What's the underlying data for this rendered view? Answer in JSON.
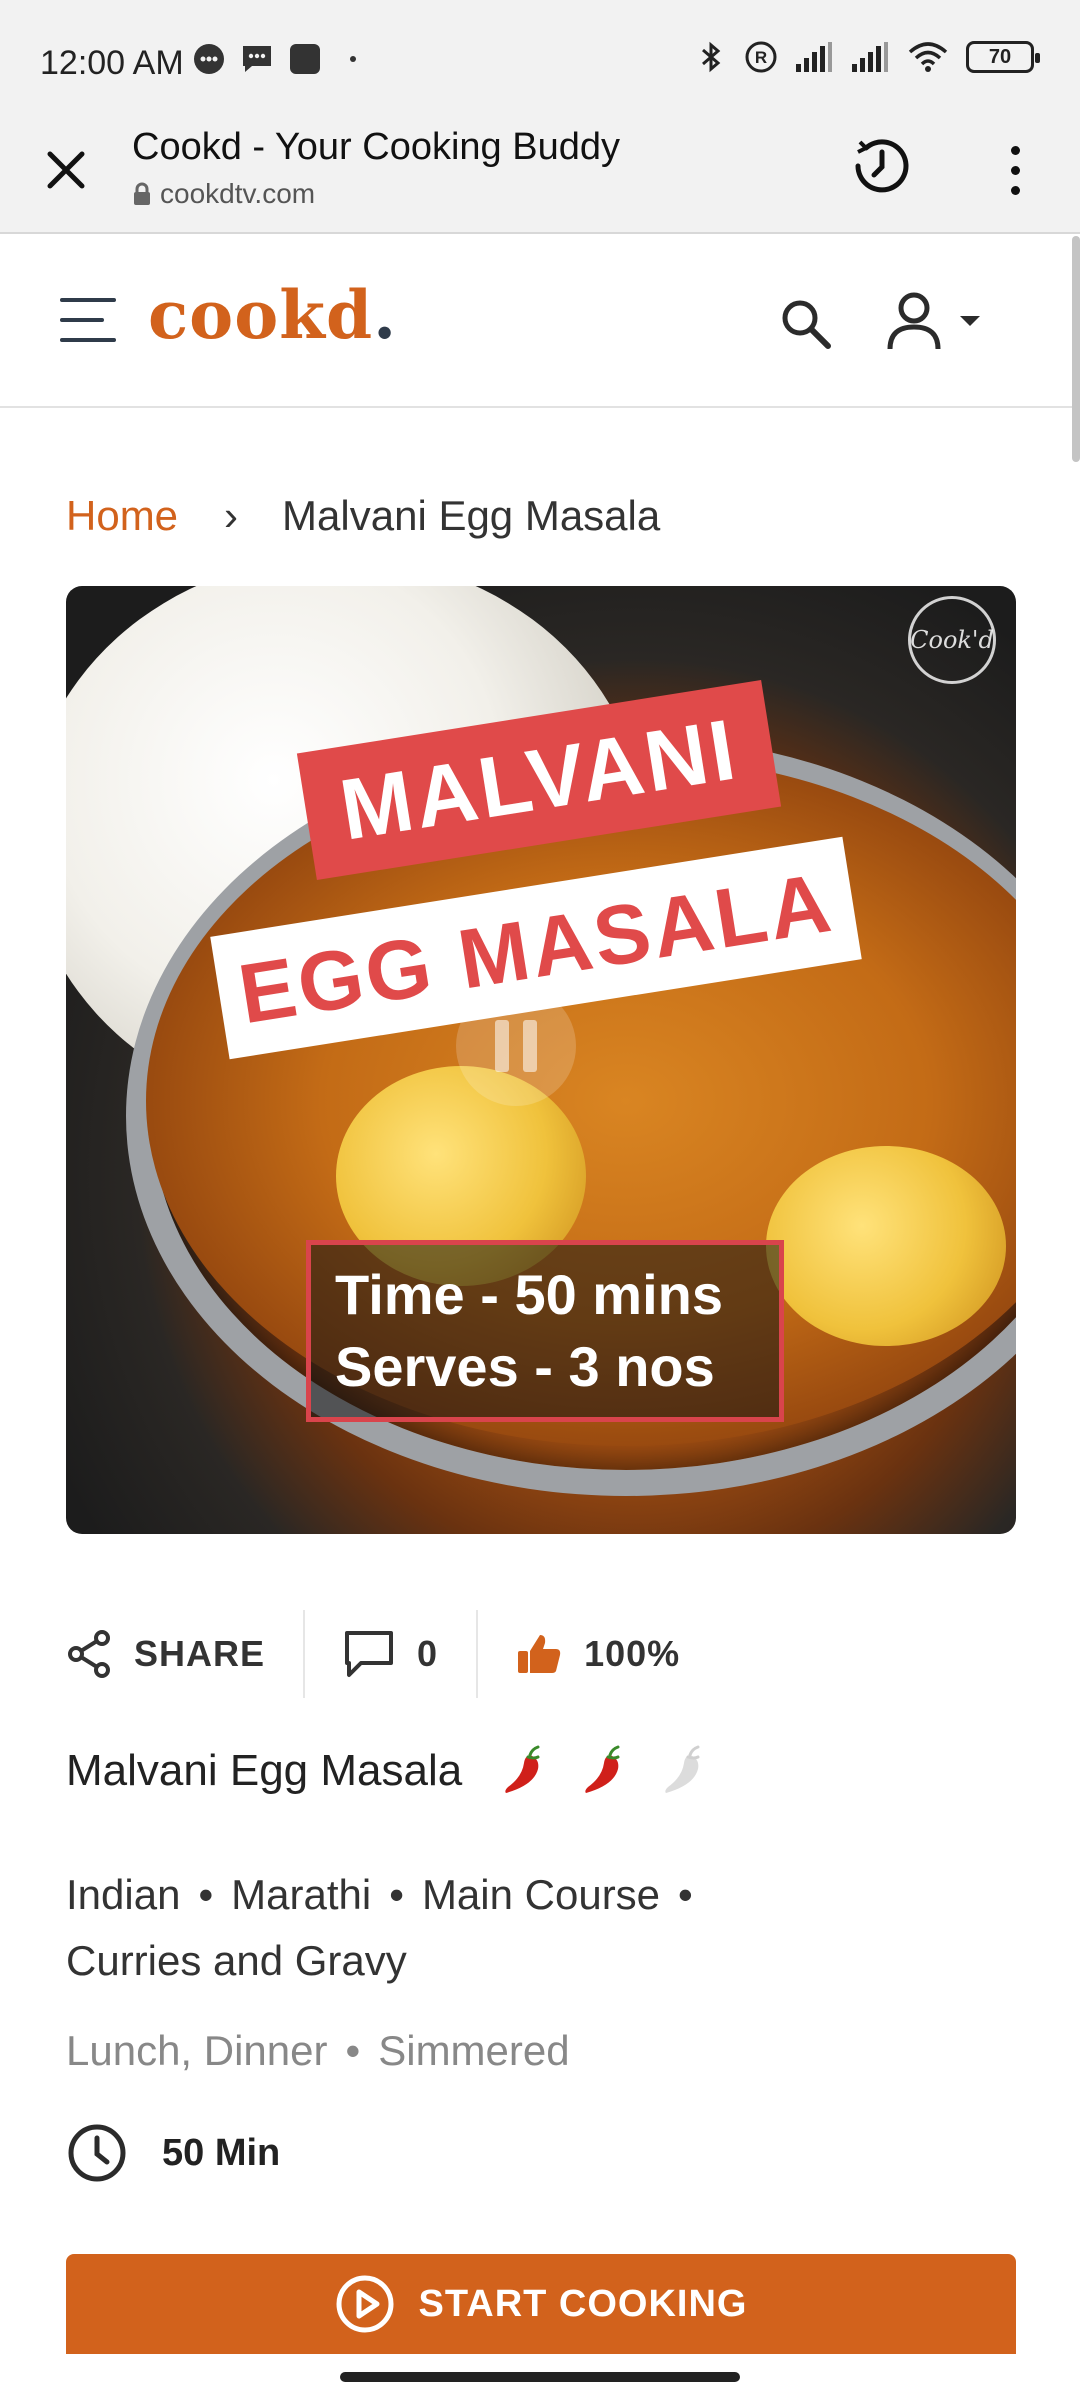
{
  "status_bar": {
    "time": "12:00 AM",
    "battery": "70",
    "left_icons": [
      "messenger-icon",
      "message-icon",
      "app-icon",
      "dot-icon"
    ],
    "right_icons": [
      "bluetooth-icon",
      "registered-icon",
      "signal-icon",
      "signal-icon",
      "wifi-icon",
      "battery-icon"
    ]
  },
  "browser": {
    "title": "Cookd - Your Cooking Buddy",
    "url": "cookdtv.com"
  },
  "site_header": {
    "logo_text": "cookd",
    "logo_dot": "."
  },
  "breadcrumb": {
    "home": "Home",
    "separator": "›",
    "current": "Malvani Egg Masala"
  },
  "video": {
    "banner_line1": "MALVANI",
    "banner_line2": "EGG MASALA",
    "info_line1": "Time - 50 mins",
    "info_line2": "Serves - 3 nos",
    "watermark": "Cook'd"
  },
  "actions": {
    "share_label": "SHARE",
    "comments_count": "0",
    "like_percent": "100%"
  },
  "recipe": {
    "title": "Malvani Egg Masala",
    "spice_level": 2,
    "spice_max": 3,
    "tags": [
      "Indian",
      "Marathi",
      "Main Course",
      "Curries and Gravy"
    ],
    "meals": [
      "Lunch, Dinner",
      "Simmered"
    ],
    "time": "50 Min"
  },
  "start_button": {
    "label": "START COOKING"
  },
  "colors": {
    "brand_orange": "#d2621c",
    "banner_red": "#e04a4a",
    "chili_red": "#d0201a",
    "chili_grey": "#dcdcdc"
  }
}
